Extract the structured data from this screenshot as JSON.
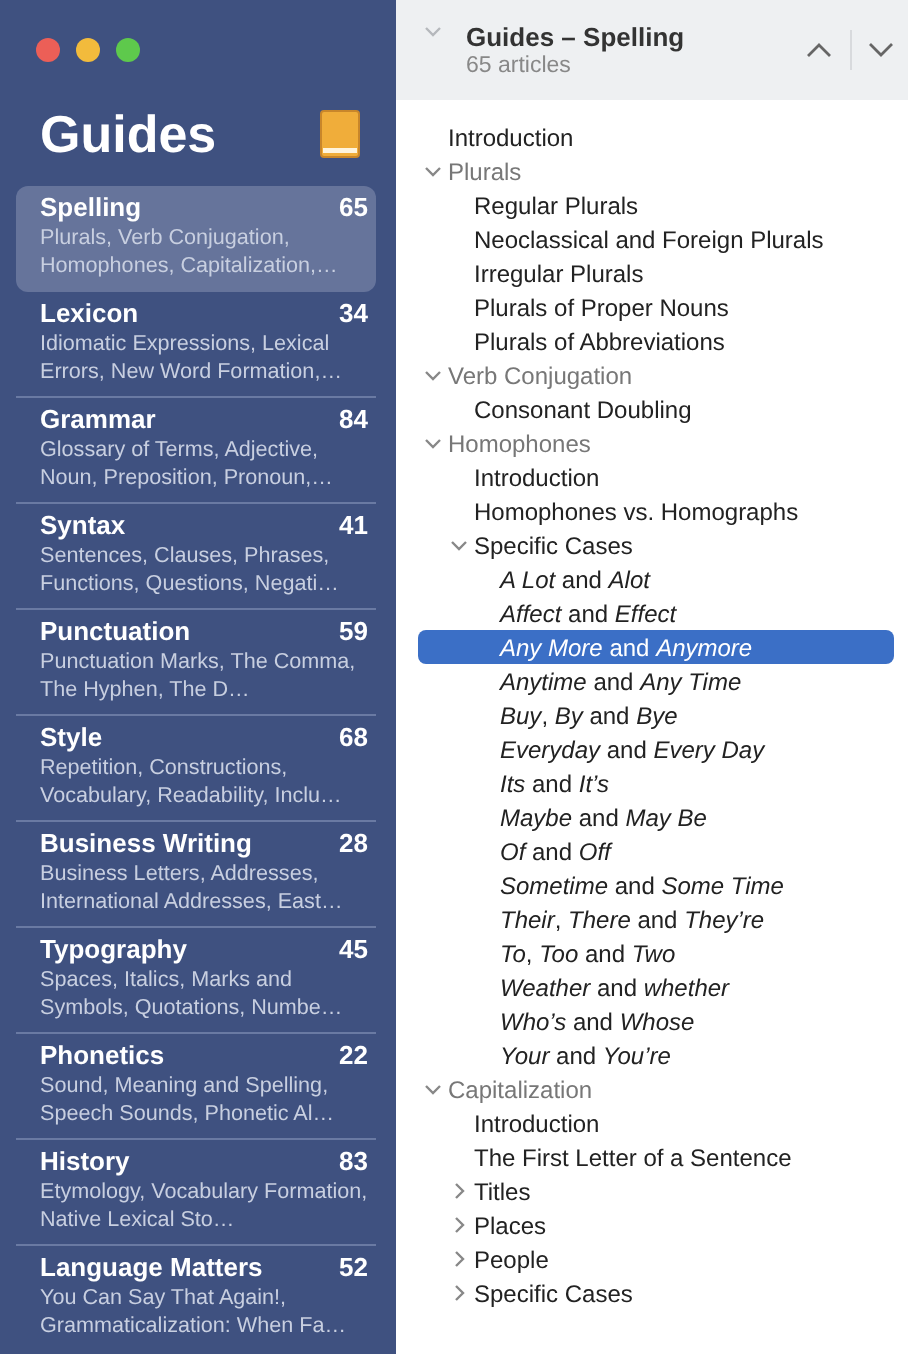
{
  "sidebar": {
    "title": "Guides",
    "items": [
      {
        "title": "Spelling",
        "count": "65",
        "description": "Plurals, Verb Conjugation, Homophones, Capitalization,…",
        "selected": true
      },
      {
        "title": "Lexicon",
        "count": "34",
        "description": "Idiomatic Expressions, Lexical Errors, New Word Formation,…",
        "selected": false
      },
      {
        "title": "Grammar",
        "count": "84",
        "description": "Glossary of Terms, Adjective, Noun, Preposition, Pronoun,…",
        "selected": false
      },
      {
        "title": "Syntax",
        "count": "41",
        "description": "Sentences, Clauses, Phrases, Functions, Questions, Negati…",
        "selected": false
      },
      {
        "title": "Punctuation",
        "count": "59",
        "description": "Punctuation Marks, The Comma, The Hyphen, The D…",
        "selected": false
      },
      {
        "title": "Style",
        "count": "68",
        "description": "Repetition, Constructions, Vocabulary, Readability, Inclu…",
        "selected": false
      },
      {
        "title": "Business Writing",
        "count": "28",
        "description": "Business Letters, Addresses, International Addresses, East…",
        "selected": false
      },
      {
        "title": "Typography",
        "count": "45",
        "description": "Spaces, Italics, Marks and Symbols, Quotations, Numbe…",
        "selected": false
      },
      {
        "title": "Phonetics",
        "count": "22",
        "description": "Sound, Meaning and Spelling, Speech Sounds, Phonetic Al…",
        "selected": false
      },
      {
        "title": "History",
        "count": "83",
        "description": "Etymology, Vocabulary Formation, Native Lexical Sto…",
        "selected": false
      },
      {
        "title": "Language Matters",
        "count": "52",
        "description": "You Can Say That Again!, Grammaticalization: When Fa…",
        "selected": false
      }
    ]
  },
  "header": {
    "title": "Guides – Spelling",
    "subtitle": "65 articles"
  },
  "tree": [
    {
      "label": "Introduction",
      "selected": false
    },
    {
      "label": "Plurals",
      "selected": false,
      "expanded": true,
      "children": [
        {
          "label": "Regular Plurals",
          "selected": false
        },
        {
          "label": "Neoclassical and Foreign Plurals",
          "selected": false
        },
        {
          "label": "Irregular Plurals",
          "selected": false
        },
        {
          "label": "Plurals of Proper Nouns",
          "selected": false
        },
        {
          "label": "Plurals of Abbreviations",
          "selected": false
        }
      ]
    },
    {
      "label": "Verb Conjugation",
      "selected": false,
      "expanded": true,
      "children": [
        {
          "label": "Consonant Doubling",
          "selected": false
        }
      ]
    },
    {
      "label": "Homophones",
      "selected": false,
      "expanded": true,
      "children": [
        {
          "label": "Introduction",
          "selected": false
        },
        {
          "label": "Homophones vs. Homographs",
          "selected": false
        },
        {
          "label": "Specific Cases",
          "selected": false,
          "expanded": true,
          "children": [
            {
              "label": "*A Lot* and *Alot*",
              "selected": false
            },
            {
              "label": "*Affect* and *Effect*",
              "selected": false
            },
            {
              "label": "*Any More* and *Anymore*",
              "selected": true
            },
            {
              "label": "*Anytime* and *Any Time*",
              "selected": false
            },
            {
              "label": "*Buy*, *By* and *Bye*",
              "selected": false
            },
            {
              "label": "*Everyday* and *Every Day*",
              "selected": false
            },
            {
              "label": "*Its* and *It’s*",
              "selected": false
            },
            {
              "label": "*Maybe* and *May Be*",
              "selected": false
            },
            {
              "label": "*Of* and *Off*",
              "selected": false
            },
            {
              "label": "*Sometime* and *Some Time*",
              "selected": false
            },
            {
              "label": "*Their*, *There* and *They’re*",
              "selected": false
            },
            {
              "label": "*To*, *Too* and *Two*",
              "selected": false
            },
            {
              "label": "*Weather* and *whether*",
              "selected": false
            },
            {
              "label": "*Who’s* and *Whose*",
              "selected": false
            },
            {
              "label": "*Your* and *You’re*",
              "selected": false
            }
          ]
        }
      ]
    },
    {
      "label": "Capitalization",
      "selected": false,
      "expanded": true,
      "children": [
        {
          "label": "Introduction",
          "selected": false
        },
        {
          "label": "The First Letter of a Sentence",
          "selected": false
        },
        {
          "label": "Titles",
          "selected": false,
          "expanded": false
        },
        {
          "label": "Places",
          "selected": false,
          "expanded": false
        },
        {
          "label": "People",
          "selected": false,
          "expanded": false
        },
        {
          "label": "Specific Cases",
          "selected": false,
          "expanded": false
        }
      ]
    }
  ]
}
